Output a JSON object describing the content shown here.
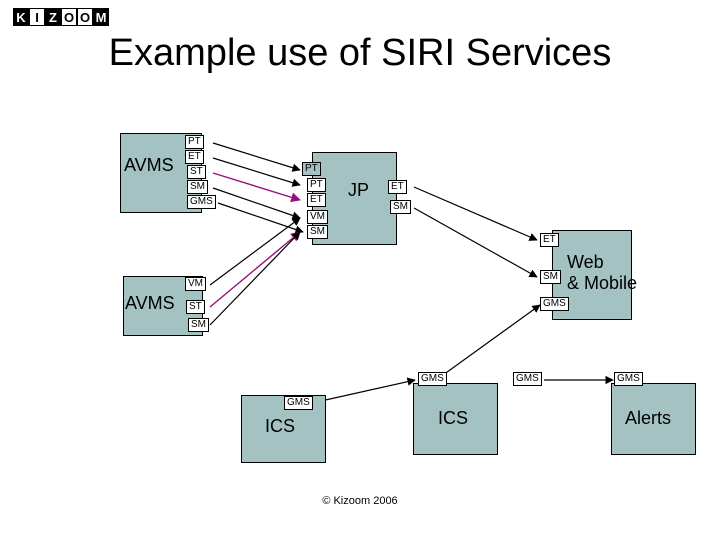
{
  "brand": {
    "letters": [
      "K",
      "I",
      "Z",
      "O",
      "O",
      "M"
    ]
  },
  "title": "Example use of SIRI Services",
  "footer": "© Kizoom 2006",
  "nodes": {
    "avms1": {
      "label": "AVMS",
      "ports": [
        "PT",
        "ET",
        "ST",
        "SM",
        "GMS"
      ]
    },
    "jp": {
      "label": "JP",
      "left_ports": [
        "PT",
        "PT",
        "ET",
        "VM",
        "SM"
      ],
      "right_ports": [
        "ET",
        "SM"
      ]
    },
    "web": {
      "label": "Web\n& Mobile",
      "left_ports": [
        "ET",
        "SM",
        "GMS"
      ]
    },
    "avms2": {
      "label": "AVMS",
      "ports": [
        "VM",
        "ST",
        "SM"
      ]
    },
    "ics1": {
      "label": "ICS",
      "ports": [
        "GMS"
      ]
    },
    "ics2": {
      "label": "ICS",
      "ports": [
        "GMS"
      ]
    },
    "alerts": {
      "label": "Alerts",
      "ports": [
        "GMS",
        "GMS"
      ]
    }
  }
}
